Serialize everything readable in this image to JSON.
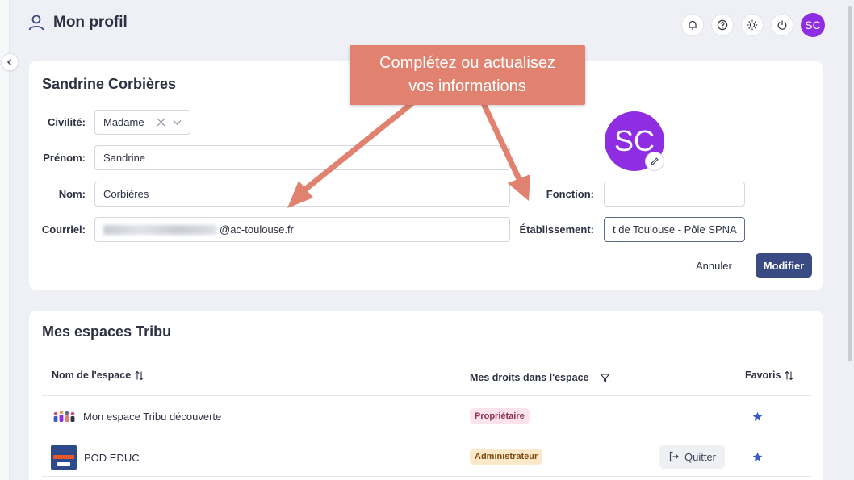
{
  "header": {
    "title": "Mon profil",
    "avatar_initials": "SC"
  },
  "profile": {
    "name": "Sandrine Corbières",
    "avatar_initials": "SC",
    "fields": {
      "civilite": {
        "label": "Civilité:",
        "value": "Madame"
      },
      "prenom": {
        "label": "Prénom:",
        "value": "Sandrine"
      },
      "nom": {
        "label": "Nom:",
        "value": "Corbières"
      },
      "courriel": {
        "label": "Courriel:",
        "value_suffix": "@ac-toulouse.fr"
      },
      "fonction": {
        "label": "Fonction:",
        "value": ""
      },
      "etablissement": {
        "label": "Établissement:",
        "value": "t de Toulouse - Pôle SPNA"
      }
    },
    "actions": {
      "cancel": "Annuler",
      "modify": "Modifier"
    }
  },
  "spaces": {
    "title": "Mes espaces Tribu",
    "columns": {
      "name": "Nom de l'espace",
      "rights": "Mes droits dans l'espace",
      "favorites": "Favoris"
    },
    "rows": [
      {
        "name": "Mon espace Tribu découverte",
        "role": "Propriétaire",
        "favorite": true
      },
      {
        "name": "POD EDUC",
        "role": "Administrateur",
        "quit": "Quitter",
        "favorite": true
      }
    ]
  },
  "callout": {
    "line1": "Complétez ou actualisez",
    "line2": "vos informations"
  },
  "colors": {
    "accent": "#3a4a82",
    "avatar": "#8e2de2",
    "callout": "#e0826f",
    "star": "#3a5bc7"
  }
}
